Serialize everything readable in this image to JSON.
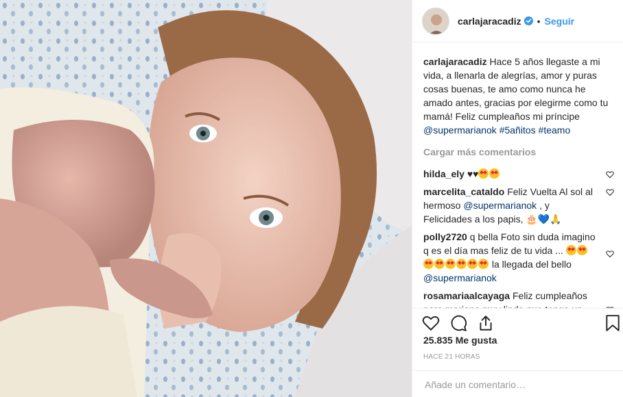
{
  "post": {
    "username": "carlajaracadiz",
    "follow_label": "Seguir",
    "separator": "•",
    "caption": {
      "author": "carlajaracadiz",
      "text": "Hace 5 años llegaste a mi vida, a llenarla de alegrías, amor y puras cosas buenas, te amo como nunca he amado antes, gracias por elegirme como tu mamá! Feliz cumpleaños mi príncipe",
      "links": [
        "@supermarianok",
        "#5añitos",
        "#teamo"
      ]
    },
    "load_more": "Cargar más comentarios",
    "comments": [
      {
        "user": "hilda_ely",
        "text": "♥♥",
        "emoji_count": 2
      },
      {
        "user": "marcelita_cataldo",
        "text_a": "Feliz Vuelta Al sol al hermoso",
        "mention": "@supermarianok",
        "text_b": ", y Felicidades a los papis,",
        "emojis": "🎂💙🙏"
      },
      {
        "user": "polly2720",
        "text_a": "q bella Foto sin duda imagino q es el día mas feliz de tu vida ...",
        "emoji_count": 8,
        "text_b": "la llegada del bello",
        "mention": "@supermarianok"
      },
      {
        "user": "rosamariaalcayaga",
        "text": "Feliz cumpleaños para mariano muy lindo que tenga un excelente dia con sus papis saudos carlita"
      }
    ],
    "likes": "25.835 Me gusta",
    "time": "HACE 21 HORAS",
    "comment_placeholder": "Añade un comentario…",
    "colors": {
      "link": "#003569",
      "follow": "#3897f0",
      "muted": "#999999"
    },
    "icons": [
      "verified-icon",
      "heart-icon",
      "comment-icon",
      "share-icon",
      "bookmark-icon"
    ]
  }
}
